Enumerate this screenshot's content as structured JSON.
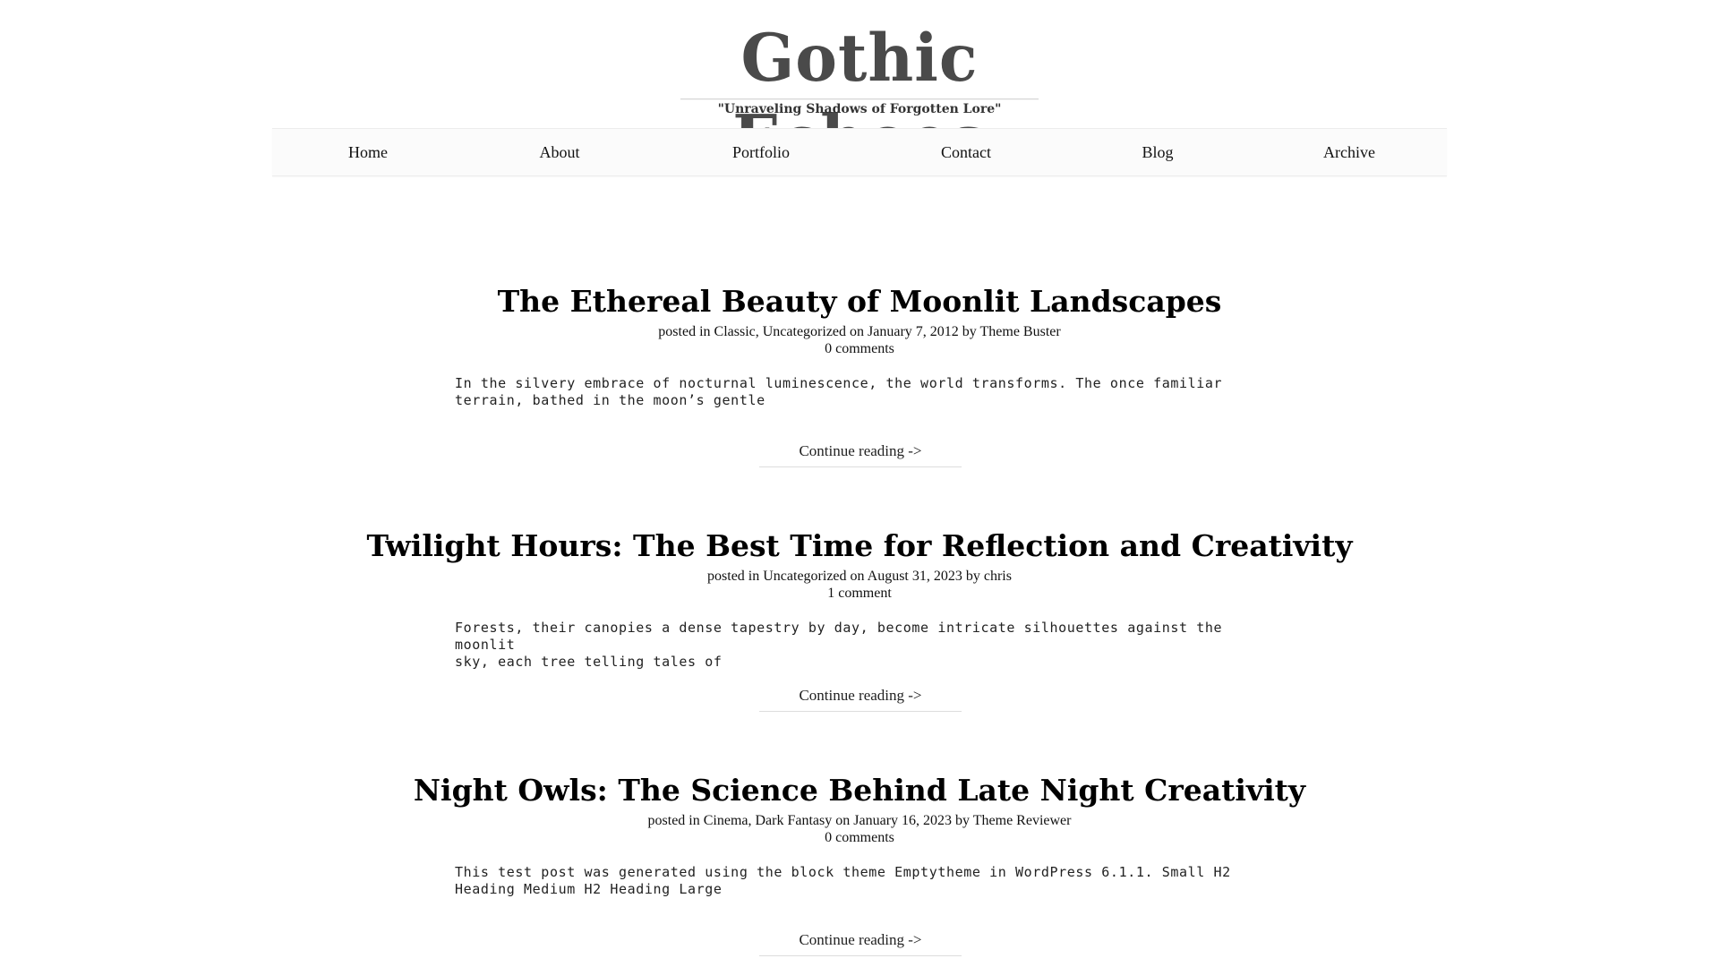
{
  "site": {
    "title": "Gothic Echoes",
    "tagline": "\"Unraveling Shadows of Forgotten Lore\""
  },
  "nav": {
    "items": [
      {
        "label": "Home"
      },
      {
        "label": "About"
      },
      {
        "label": "Portfolio"
      },
      {
        "label": "Contact"
      },
      {
        "label": "Blog"
      },
      {
        "label": "Archive"
      }
    ]
  },
  "posts": [
    {
      "title": "The Ethereal Beauty of Moonlit Landscapes",
      "posted_in_label": "posted in",
      "categories": [
        "Classic",
        "Uncategorized"
      ],
      "on_label": "on",
      "date": "January 7, 2012",
      "by_label": "by",
      "author": "Theme Buster",
      "comments": "0 comments",
      "excerpt": "  In the silvery embrace of nocturnal luminescence, the world transforms. The once familiar\nterrain, bathed in the moon’s gentle",
      "continue": "Continue reading ->"
    },
    {
      "title": "Twilight Hours: The Best Time for Reflection and Creativity",
      "posted_in_label": "posted in",
      "categories": [
        "Uncategorized"
      ],
      "on_label": "on",
      "date": "August 31, 2023",
      "by_label": "by",
      "author": "chris",
      "comments": "1 comment",
      "excerpt": "Forests, their canopies a dense tapestry by day, become intricate silhouettes against the moonlit\nsky, each tree telling tales of",
      "continue": "Continue reading ->"
    },
    {
      "title": "Night Owls: The Science Behind Late Night Creativity",
      "posted_in_label": "posted in",
      "categories": [
        "Cinema",
        "Dark Fantasy"
      ],
      "on_label": "on",
      "date": "January 16, 2023",
      "by_label": "by",
      "author": "Theme Reviewer",
      "comments": "0 comments",
      "excerpt": "This test post was generated using the block theme Emptytheme in WordPress 6.1.1. Small H2\nHeading Medium H2 Heading Large",
      "continue": "Continue reading ->"
    }
  ]
}
